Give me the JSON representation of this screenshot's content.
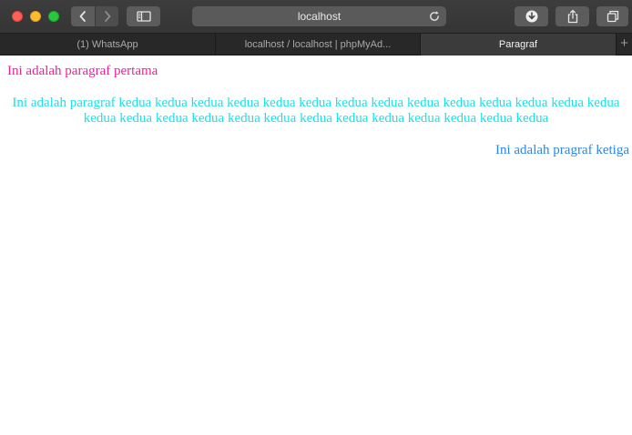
{
  "window": {
    "address": "localhost"
  },
  "tabs": [
    {
      "label": "(1) WhatsApp",
      "active": false
    },
    {
      "label": "localhost / localhost | phpMyAd...",
      "active": false
    },
    {
      "label": "Paragraf",
      "active": true
    }
  ],
  "toolbar": {
    "back_icon": "chevron-left-icon",
    "forward_icon": "chevron-right-icon",
    "sidebar_icon": "sidebar-icon",
    "reload_icon": "reload-icon",
    "download_icon": "download-icon",
    "share_icon": "share-icon",
    "tabs_icon": "tabs-overview-icon",
    "new_tab_label": "+"
  },
  "page": {
    "paragraphs": [
      {
        "text": "Ini adalah paragraf pertama",
        "color": "#f0209a"
      },
      {
        "text": "Ini adalah paragraf kedua kedua kedua kedua kedua kedua kedua kedua kedua kedua kedua kedua kedua kedua kedua kedua kedua kedua kedua kedua kedua kedua kedua kedua kedua kedua kedua",
        "color": "#19e1ea"
      },
      {
        "text": "Ini adalah pragraf ketiga",
        "color": "#2d86e6"
      }
    ]
  }
}
